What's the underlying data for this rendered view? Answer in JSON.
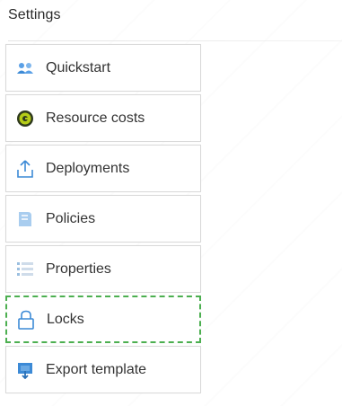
{
  "header": {
    "title": "Settings"
  },
  "menu": {
    "items": [
      {
        "label": "Quickstart",
        "icon": "quickstart-icon"
      },
      {
        "label": "Resource costs",
        "icon": "resource-costs-icon"
      },
      {
        "label": "Deployments",
        "icon": "deployments-icon"
      },
      {
        "label": "Policies",
        "icon": "policies-icon"
      },
      {
        "label": "Properties",
        "icon": "properties-icon"
      },
      {
        "label": "Locks",
        "icon": "lock-icon",
        "selected": true
      },
      {
        "label": "Export template",
        "icon": "export-template-icon"
      }
    ]
  },
  "colors": {
    "accent_blue": "#3c8ad6",
    "selected_border": "#4caf50",
    "cost_green": "#b5cc18"
  }
}
